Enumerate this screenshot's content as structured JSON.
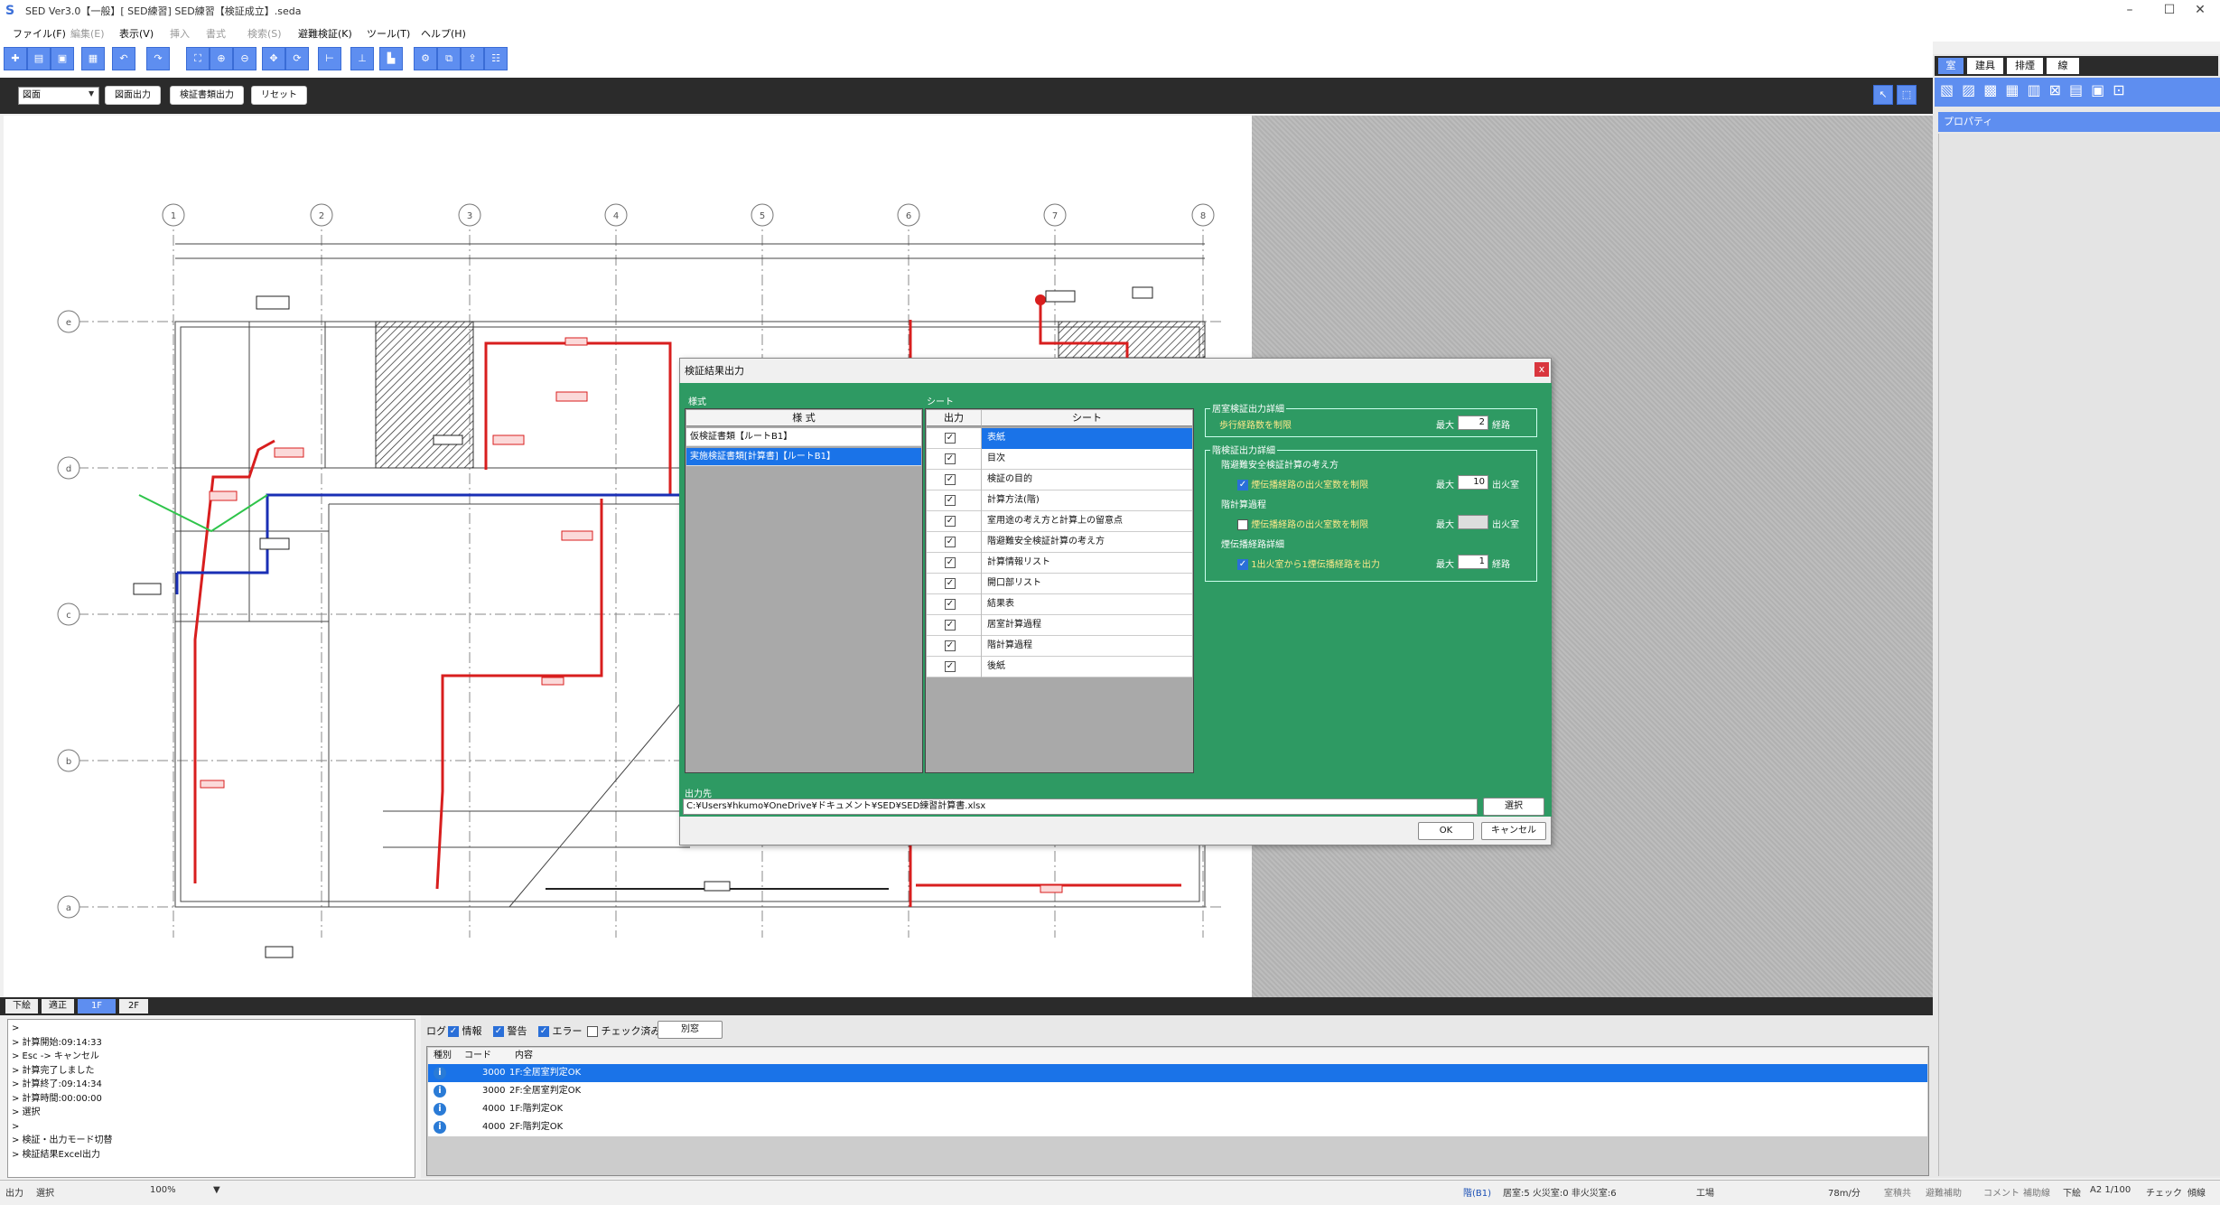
{
  "window": {
    "title": "SED Ver3.0【一般】[ SED練習] SED練習【検証成立】.seda",
    "icon": "S",
    "controls": [
      "–",
      "☐",
      "✕"
    ]
  },
  "menu": [
    {
      "label": "ファイル(F)",
      "enabled": true
    },
    {
      "label": "編集(E)",
      "enabled": false
    },
    {
      "label": "表示(V)",
      "enabled": true
    },
    {
      "label": "挿入",
      "enabled": false
    },
    {
      "label": "書式",
      "enabled": false
    },
    {
      "label": "検索(S)",
      "enabled": false
    },
    {
      "label": "避難検証(K)",
      "enabled": true
    },
    {
      "label": "ツール(T)",
      "enabled": true
    },
    {
      "label": "ヘルプ(H)",
      "enabled": true
    }
  ],
  "toolbar2": {
    "mode_select": "図面",
    "buttons": [
      "図面出力",
      "検証書類出力",
      "リセット"
    ]
  },
  "right_panel": {
    "tabs": [
      "室",
      "建具",
      "排煙",
      "線"
    ],
    "property_title": "プロパティ"
  },
  "drawing": {
    "columns": [
      "1",
      "2",
      "3",
      "4",
      "5",
      "6",
      "7",
      "8"
    ],
    "rows": [
      "e",
      "d",
      "c",
      "b",
      "a"
    ]
  },
  "floor_tabs": [
    "下絵",
    "適正",
    "1F",
    "2F"
  ],
  "console_lines": [
    ">",
    "> 計算開始:09:14:33",
    "> Esc -> キャンセル",
    "> 計算完了しました",
    "> 計算終了:09:14:34",
    "> 計算時間:00:00:00",
    "> 選択",
    ">",
    "> 検証・出力モード切替",
    "> 検証結果Excel出力"
  ],
  "log": {
    "label": "ログ",
    "filters": [
      {
        "label": "情報",
        "checked": true
      },
      {
        "label": "警告",
        "checked": true
      },
      {
        "label": "エラー",
        "checked": true
      },
      {
        "label": "チェック済み",
        "checked": false
      }
    ],
    "separate_button": "別窓",
    "columns": [
      "種別",
      "コード",
      "内容"
    ],
    "rows": [
      {
        "code": "3000",
        "content": "1F:全居室判定OK",
        "selected": true
      },
      {
        "code": "3000",
        "content": "2F:全居室判定OK",
        "selected": false
      },
      {
        "code": "4000",
        "content": "1F:階判定OK",
        "selected": false
      },
      {
        "code": "4000",
        "content": "2F:階判定OK",
        "selected": false
      }
    ]
  },
  "dialog": {
    "title": "検証結果出力",
    "close": "x",
    "style_section": "様式",
    "style_header": "様 式",
    "styles": [
      {
        "label": "仮検証書類【ルートB1】",
        "selected": false
      },
      {
        "label": "実施検証書類[計算書]【ルートB1】",
        "selected": true
      }
    ],
    "sheet_section": "シート",
    "sheet_headers": [
      "出力",
      "シート"
    ],
    "sheets": [
      {
        "label": "表紙",
        "checked": true,
        "selected": true
      },
      {
        "label": "目次",
        "checked": true,
        "selected": false
      },
      {
        "label": "検証の目的",
        "checked": true,
        "selected": false
      },
      {
        "label": "計算方法(階)",
        "checked": true,
        "selected": false
      },
      {
        "label": "室用途の考え方と計算上の留意点",
        "checked": true,
        "selected": false
      },
      {
        "label": "階避難安全検証計算の考え方",
        "checked": true,
        "selected": false
      },
      {
        "label": "計算情報リスト",
        "checked": true,
        "selected": false
      },
      {
        "label": "開口部リスト",
        "checked": true,
        "selected": false
      },
      {
        "label": "結果表",
        "checked": true,
        "selected": false
      },
      {
        "label": "居室計算過程",
        "checked": true,
        "selected": false
      },
      {
        "label": "階計算過程",
        "checked": true,
        "selected": false
      },
      {
        "label": "後紙",
        "checked": true,
        "selected": false
      }
    ],
    "room_group": {
      "title": "居室検証出力詳細",
      "option": "歩行経路数を制限",
      "max_label": "最大",
      "value": "2",
      "unit": "経路"
    },
    "floor_group": {
      "title": "階検証出力詳細",
      "subgroups": [
        {
          "title": "階避難安全検証計算の考え方",
          "option": "煙伝播経路の出火室数を制限",
          "checked": true,
          "max_label": "最大",
          "value": "10",
          "unit": "出火室",
          "enabled": true
        },
        {
          "title": "階計算過程",
          "option": "煙伝播経路の出火室数を制限",
          "checked": false,
          "max_label": "最大",
          "value": "",
          "unit": "出火室",
          "enabled": false
        },
        {
          "title": "煙伝播経路詳細",
          "option": "1出火室から1煙伝播経路を出力",
          "checked": true,
          "max_label": "最大",
          "value": "1",
          "unit": "経路",
          "enabled": true
        }
      ]
    },
    "output_label": "出力先",
    "output_path": "C:¥Users¥hkumo¥OneDrive¥ドキュメント¥SED¥SED練習計算書.xlsx",
    "select_button": "選択",
    "ok": "OK",
    "cancel": "キャンセル"
  },
  "status": {
    "left": "出力",
    "mode": "選択",
    "zoom": "100%",
    "floor": "階(B1)",
    "counts": "居室:5 火災室:0 非火災室:6",
    "use": "工場",
    "speed": "78m/分",
    "right": [
      "室積共",
      "避難補助",
      "コメント",
      "補助線",
      "下絵",
      "A2 1/100",
      "チェック",
      "傾線"
    ]
  },
  "colors": {
    "accent": "#5e8ef0",
    "dialog_green": "#2e9a63",
    "selection": "#1a73e8",
    "route_red": "#d81e1e",
    "route_blue": "#1a2fb5"
  }
}
